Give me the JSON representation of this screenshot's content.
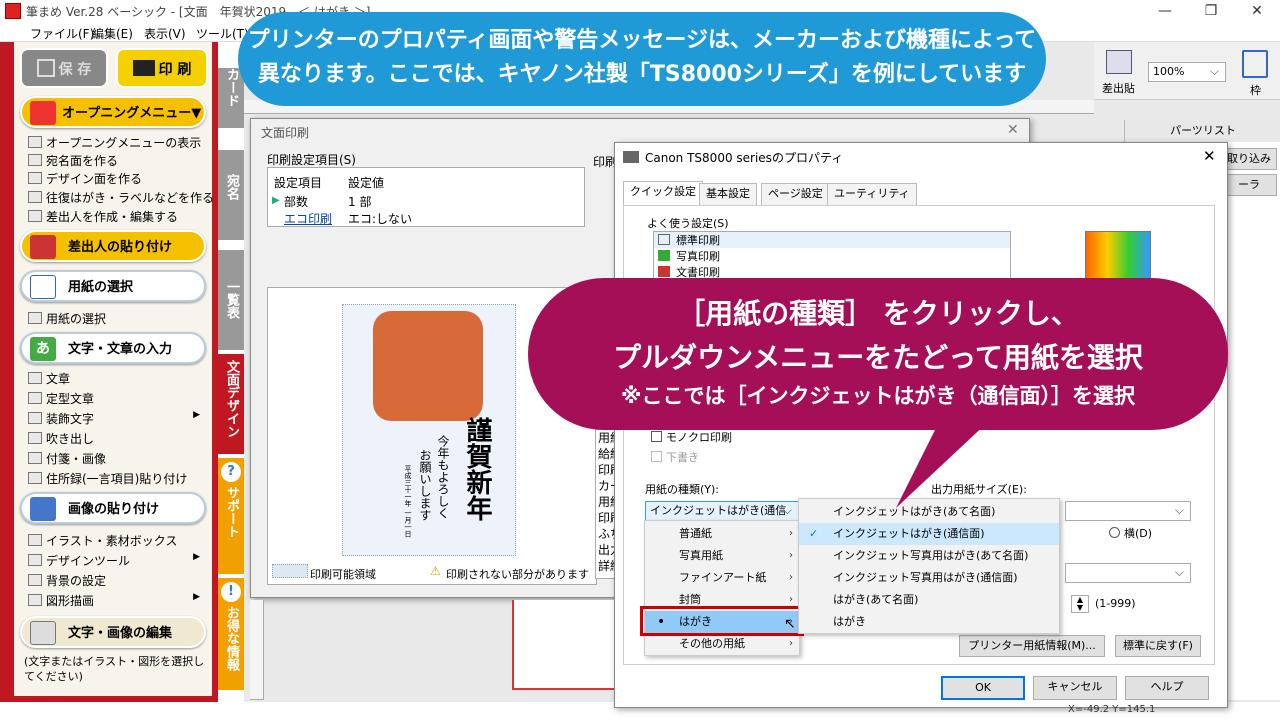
{
  "app": {
    "title": "筆まめ Ver.28 ベーシック - [文面　年賀状2019　＜ はがき ＞]",
    "menu": [
      "ファイル(F)",
      "編集(E)",
      "表示(V)",
      "ツール(T)"
    ]
  },
  "left_panel": {
    "save_label": "保 存",
    "print_label": "印 刷",
    "opening_label": "オープニングメニュー▼",
    "opening_items": [
      "オープニングメニューの表示",
      "宛名面を作る",
      "デザイン面を作る",
      "往復はがき・ラベルなどを作る",
      "差出人を作成・編集する"
    ],
    "sender_label": "差出人の貼り付け",
    "paper_label": "用紙の選択",
    "paper_items": [
      "用紙の選択"
    ],
    "text_label": "文字・文章の入力",
    "text_items": [
      "文章",
      "定型文章",
      "装飾文字",
      "吹き出し",
      "付箋・画像",
      "住所録(一言項目)貼り付け"
    ],
    "image_label": "画像の貼り付け",
    "image_items": [
      "イラスト・素材ボックス",
      "デザインツール",
      "背景の設定",
      "図形描画"
    ],
    "edit_label": "文字・画像の編集",
    "edit_hint": "(文字またはイラスト・図形を選択してください)"
  },
  "side_tabs": {
    "card": "カード",
    "atena": "宛名",
    "ichiran": "一覧表",
    "design": "文面デザイン",
    "support": "サポート",
    "otoku": "お得な情報"
  },
  "toolbar_right": {
    "sashidashi": "差出貼",
    "zoom": "100%",
    "waku": "枠",
    "parts_list": "パーツリスト",
    "torikomi": "取り込み",
    "ra": "ーラ"
  },
  "print_dialog": {
    "title": "文面印刷",
    "settings_label": "印刷設定項目(S)",
    "col_item": "設定項目",
    "col_value": "設定値",
    "rows": [
      {
        "item": "部数",
        "value": "1 部"
      },
      {
        "item": "エコ印刷",
        "value": "エコ:しない"
      }
    ],
    "right_label": "印刷",
    "right_items": [
      "用紙",
      "給紙",
      "印刷",
      "カー",
      "用紙",
      "印刷",
      "ふち",
      "出力",
      "詳細"
    ],
    "preview_text_main": "謹賀新年",
    "preview_text_2": "今年もよろしく",
    "preview_text_3": "お願いします",
    "preview_text_4": "平成三十一年 一月一日",
    "printable_area": "印刷可能領域",
    "warning": "印刷されない部分があります"
  },
  "canon_dialog": {
    "title": "Canon TS8000 seriesのプロパティ",
    "tabs": [
      "クイック設定",
      "基本設定",
      "ページ設定",
      "ユーティリティ"
    ],
    "favorites_label": "よく使う設定(S)",
    "favorites": [
      "標準印刷",
      "写真印刷",
      "文書印刷"
    ],
    "mono_label": "モノクロ印刷",
    "draft_label": "下書き",
    "media_label": "用紙の種類(Y):",
    "media_value": "インクジェットはがき(通信面)",
    "output_size_label": "出力用紙サイズ(E):",
    "orientation_label": "横(D)",
    "copies_range": "(1-999)",
    "printer_info_btn": "プリンター用紙情報(M)...",
    "reset_btn": "標準に戻す(F)",
    "ok": "OK",
    "cancel": "キャンセル",
    "help": "ヘルプ"
  },
  "dropdown": {
    "categories": [
      "普通紙",
      "写真用紙",
      "ファインアート紙",
      "封筒",
      "はがき",
      "その他の用紙"
    ],
    "selected_category": "はがき",
    "submenu": [
      "インクジェットはがき(あて名面)",
      "インクジェットはがき(通信面)",
      "インクジェット写真用はがき(あて名面)",
      "インクジェット写真用はがき(通信面)",
      "はがき(あて名面)",
      "はがき"
    ],
    "checked": "インクジェットはがき(通信面)"
  },
  "callouts": {
    "blue_line1": "プリンターのプロパティ画面や警告メッセージは、メーカーおよび機種によって",
    "blue_line2": "異なります。ここでは、キヤノン社製「TS8000シリーズ」を例にしています",
    "bubble_line1": "［用紙の種類］ をクリックし、",
    "bubble_line2": "プルダウンメニューをたどって用紙を選択",
    "bubble_line3": "※ここでは［インクジェットはがき（通信面）］を選択"
  },
  "status": {
    "coords": "X=-49.2  Y=145.1"
  },
  "colors": {
    "panel_red": "#c01820",
    "banner_blue": "#1f9ad6",
    "bubble_magenta": "#a40f57",
    "accent_yellow": "#f5c000"
  }
}
